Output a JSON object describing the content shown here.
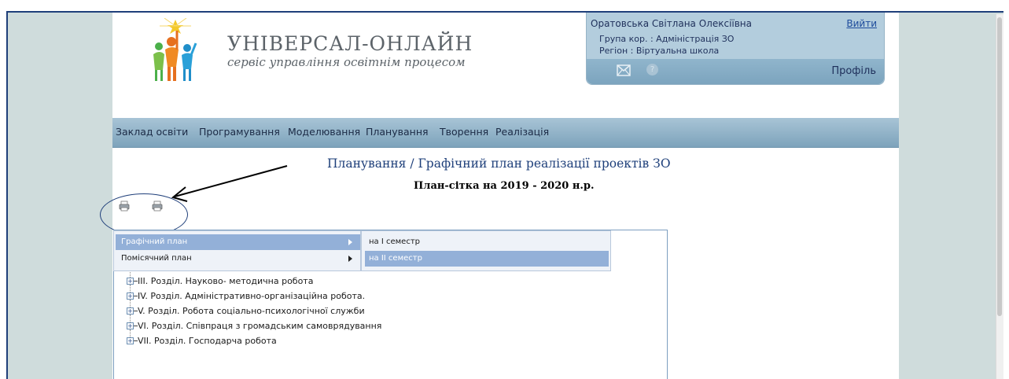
{
  "header": {
    "brand_title": "УНІВЕРСАЛ-ОНЛАЙН",
    "brand_subtitle": "сервіс управління освітнім процесом"
  },
  "user_panel": {
    "user_name": "Оратовська Світлана Олексіївна",
    "logout_label": "Вийти",
    "group": "Група кор. : Адміністрація ЗО",
    "region": "Регіон : Віртуальна школа",
    "profile_label": "Профіль",
    "help_symbol": "?",
    "icons": [
      "mail-icon",
      "help-icon"
    ]
  },
  "nav": {
    "items": [
      "Заклад освіти",
      "Програмування",
      "Моделювання",
      "Планування",
      "Творення",
      "Реалізація"
    ]
  },
  "breadcrumb": "Планування / Графічний план реалізації проектів ЗО",
  "plan_title": "План-сітка на 2019 - 2020 н.р.",
  "print_icons": [
    "printer-icon",
    "printer-icon"
  ],
  "menu": {
    "items": [
      {
        "label": "Графічний план",
        "active": true
      },
      {
        "label": "Помісячний план",
        "active": false
      }
    ]
  },
  "submenu": {
    "items": [
      {
        "label": "на І семестр",
        "active": false
      },
      {
        "label": "на ІІ семестр",
        "active": true
      }
    ]
  },
  "tree": {
    "items": [
      "III. Розділ. Науково- методична робота",
      "IV. Розділ. Адміністративно-організаційна робота.",
      "V. Розділ. Робота соціально-психологічної служби",
      "VI. Розділ. Співпраця з громадським самоврядування",
      "VII. Розділ. Господарча робота"
    ],
    "expander_symbol": "+"
  },
  "colors": {
    "nav_bar": "#8fb1c7",
    "user_panel": "#b3cddd",
    "menu_active": "#93b0d8",
    "breadcrumb": "#1e3f7a",
    "frame_bg": "#cfdcdc"
  }
}
